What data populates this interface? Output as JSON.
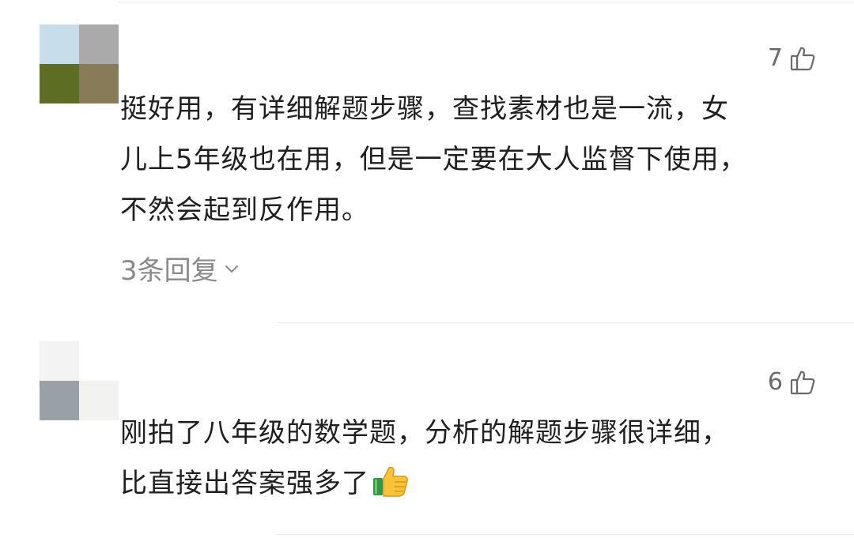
{
  "comments": [
    {
      "like_count": "7",
      "lines": [
        "挺好用，有详细解题步骤，查找素材也是一流，女",
        "儿上5年级也在用，但是一定要在大人监督下使用，",
        "不然会起到反作用。"
      ],
      "replies_label": "3条回复",
      "avatar_colors": [
        "#c7dde9",
        "#aaaaaa",
        "#5e6d24",
        "#877b58"
      ]
    },
    {
      "like_count": "6",
      "lines": [
        "刚拍了八年级的数学题，分析的解题步骤很详细，",
        "比直接出答案强多了"
      ],
      "emoji": "thumbs-up",
      "avatar_colors": [
        "#f3f3f3",
        "#ffffff",
        "#9aa1a6",
        "#f2f2f0"
      ]
    }
  ],
  "colors": {
    "text": "#1f1f1f",
    "secondary": "#8a8a8a",
    "icon": "#6a6a6a",
    "divider": "#ececec"
  }
}
